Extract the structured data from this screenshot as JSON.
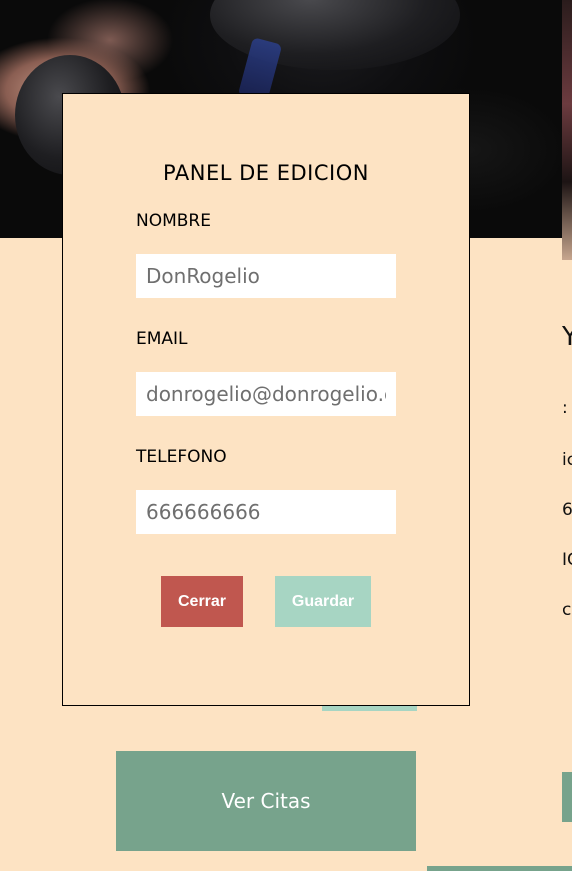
{
  "panel": {
    "title": "PANEL DE EDICION",
    "fields": {
      "nombre": {
        "label": "NOMBRE",
        "value": "DonRogelio"
      },
      "email": {
        "label": "EMAIL",
        "value": "donrogelio@donrogelio.com"
      },
      "telefono": {
        "label": "TELEFONO",
        "value": "666666666"
      }
    },
    "buttons": {
      "close": "Cerrar",
      "save": "Guardar"
    }
  },
  "background": {
    "ver_citas": "Ver Citas",
    "side_title": "Y",
    "side_lines": [
      ":",
      "ic",
      "6",
      "IC",
      "c"
    ]
  },
  "colors": {
    "page_bg": "#fde3c3",
    "close_button": "#c0574f",
    "save_button": "#a7d5c3",
    "ver_citas_button": "#77a38c"
  }
}
